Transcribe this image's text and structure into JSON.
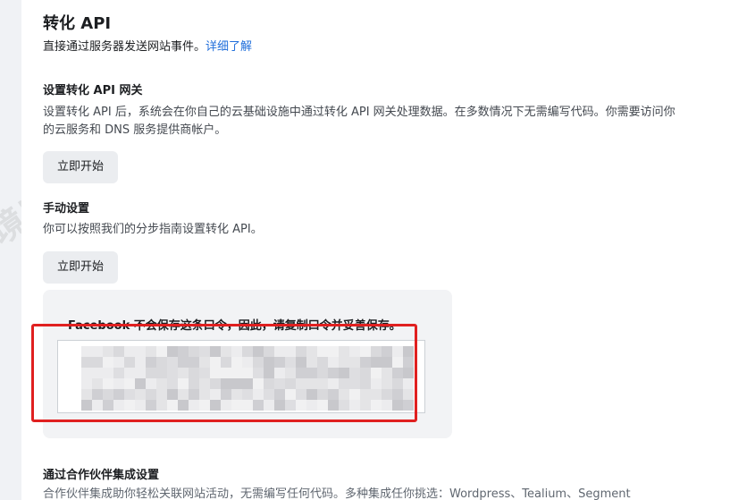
{
  "header": {
    "title": "转化 API",
    "subtitle": "直接通过服务器发送网站事件。",
    "learn_more": "详细了解"
  },
  "gateway": {
    "heading": "设置转化 API 网关",
    "description": "设置转化 API 后，系统会在你自己的云基础设施中通过转化 API 网关处理数据。在多数情况下无需编写代码。你需要访问你的云服务和 DNS 服务提供商帐户。",
    "button": "立即开始"
  },
  "manual": {
    "heading": "手动设置",
    "description": "你可以按照我们的分步指南设置转化 API。",
    "button": "立即开始"
  },
  "token": {
    "notice": "Facebook 不会保存这条口令，因此，请复制口令并妥善保存。",
    "value_obscured": true
  },
  "partners": {
    "heading": "通过合作伙伴集成设置",
    "description": "合作伙伴集成助你轻松关联网站活动，无需编写任何代码。多种集成任你挑选：Wordpress、Tealium、Segment"
  },
  "watermark": {
    "text": "跨境出海陆路"
  },
  "colors": {
    "link": "#216fdb",
    "highlight": "#e02020",
    "button_bg": "#ebedf0"
  }
}
